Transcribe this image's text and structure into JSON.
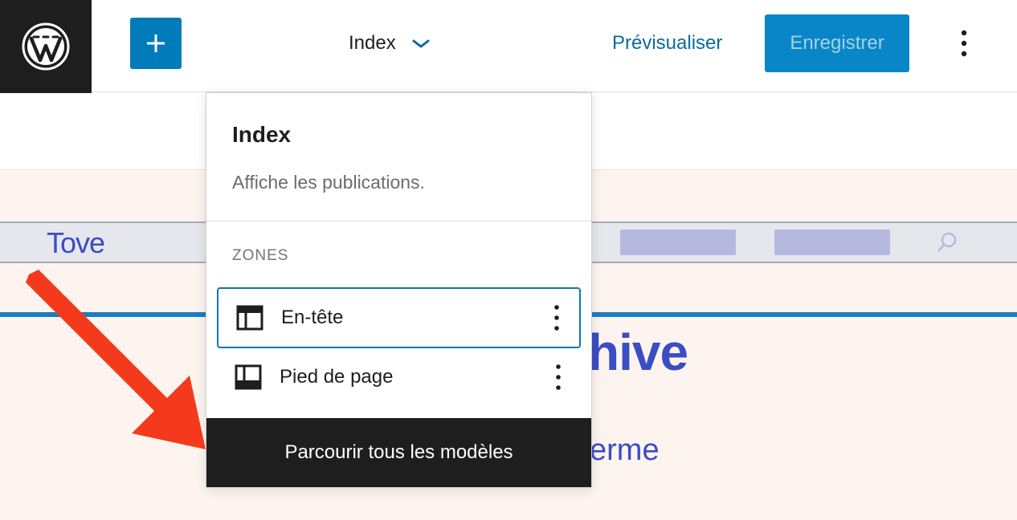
{
  "header": {
    "document_title": "Index",
    "preview_label": "Prévisualiser",
    "save_label": "Enregistrer"
  },
  "dropdown": {
    "title": "Index",
    "description": "Affiche les publications.",
    "section_label": "ZONES",
    "zones": [
      {
        "label": "En-tête",
        "selected": true
      },
      {
        "label": "Pied de page",
        "selected": false
      }
    ],
    "browse_label": "Parcourir tous les modèles"
  },
  "canvas": {
    "site_title": "Tove",
    "heading_fragment": "hive",
    "text_fragment": "erme"
  },
  "colors": {
    "accent": "#007cba",
    "dark": "#1e1e1e",
    "site_blue": "#3a4dc4",
    "canvas_bg": "#fdf4ef",
    "arrow_red": "#f4391c"
  },
  "icons": {
    "logo": "wordpress-logo-icon",
    "add": "plus-icon",
    "title_toggle": "chevron-down-icon",
    "options": "vertical-ellipsis-icon",
    "header_zone": "header-layout-icon",
    "footer_zone": "footer-layout-icon",
    "search": "search-icon",
    "pointer": "red-arrow-icon"
  }
}
